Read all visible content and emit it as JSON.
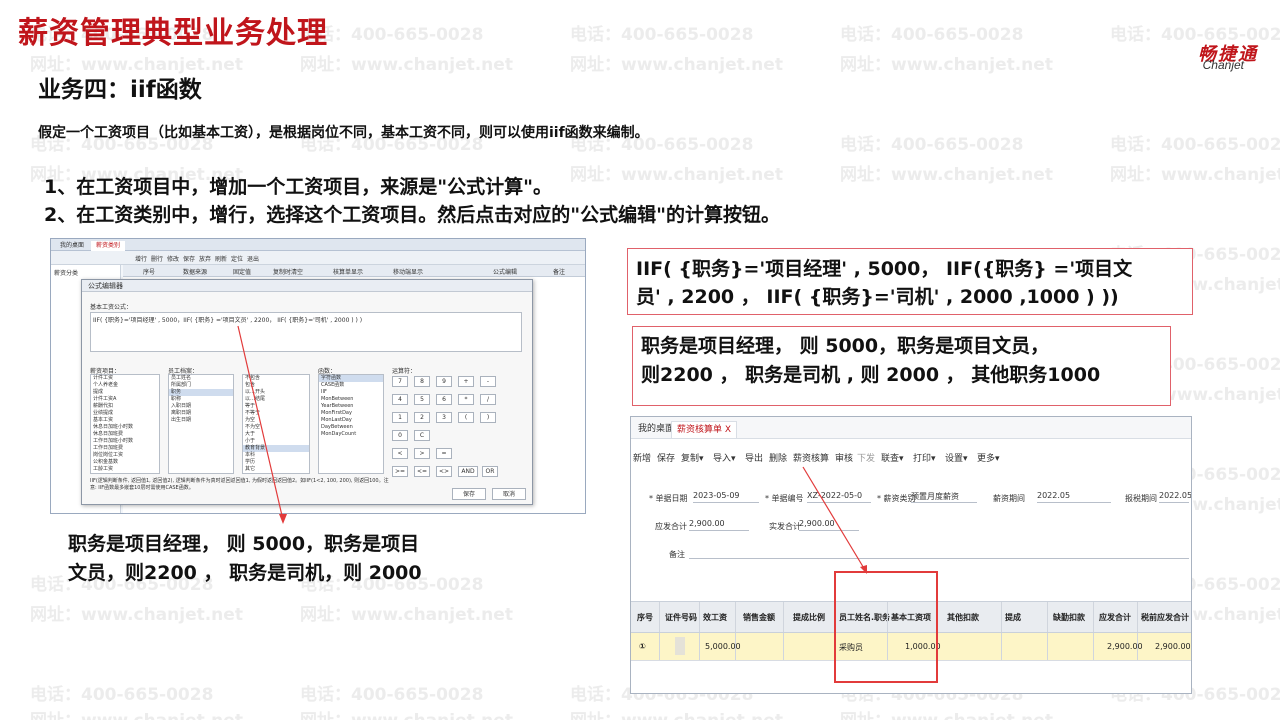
{
  "header": {
    "title": "薪资管理典型业务处理",
    "logo_cn": "畅捷通",
    "logo_en": "Chanjet"
  },
  "watermark": {
    "phone": "电话：400-665-0028",
    "web": "网址：www.chanjet.net"
  },
  "section": {
    "title": "业务四：iif函数",
    "intro": "假定一个工资项目（比如基本工资），是根据岗位不同，基本工资不同，则可以使用iif函数来编制。",
    "steps": [
      "1、在工资项目中，增加一个工资项目，来源是\"公式计算\"。",
      "2、在工资类别中，增行，选择这个工资项目。然后点击对应的\"公式编辑\"的计算按钮。"
    ]
  },
  "formula_box": {
    "line1": "IIF( {职务}='项目经理' , 5000， IIF({职务} ='项目文",
    "line2": "员' , 2200 ，  IIF( {职务}='司机' ,  2000 ,1000 ) ))"
  },
  "explain_box": {
    "line1": "职务是项目经理， 则 5000，职务是项目文员，",
    "line2": "则2200 ， 职务是司机 , 则 2000 ， 其他职务1000"
  },
  "left_explain": {
    "line1": "职务是项目经理， 则 5000，职务是项目",
    "line2": "文员，则2200 ， 职务是司机，则 2000"
  },
  "left_shot": {
    "tabs": [
      "我的桌面",
      "薪资类别"
    ],
    "toolbar": [
      "增行",
      "删行",
      "修改",
      "保存",
      "放弃",
      "刷新",
      "定位",
      "退出"
    ],
    "tree_title": "薪资分类",
    "grid_headers": [
      "序号",
      "数据来源",
      "固定值",
      "复制时清空",
      "核算单显示",
      "移动端显示",
      "公式编辑",
      "备注"
    ],
    "dialog": {
      "title": "公式编辑器",
      "label_formula": "基本工资公式：",
      "formula_text": "IIF( {职务}='项目经理' , 5000，IIF( {职务} ='项目文员' , 2200， IIF( {职务}='司机' ,  2000 ) ) )",
      "list_labels": [
        "薪资项目：",
        "员工档案：",
        "函数：",
        "运算符："
      ],
      "salary_items": [
        "计件工资",
        "个人养老金",
        "提成",
        "计件工资A",
        "薪酬代扣",
        "业绩提成",
        "基本工资",
        "休息日加班小时数",
        "休息日加班费",
        "工作日加班小时数",
        "工作日加班费",
        "岗位岗位工资",
        "公积金基数",
        "工龄工资"
      ],
      "employee_items": [
        "员工姓名",
        "所属部门",
        "职务",
        "职称",
        "入职日期",
        "离职日期",
        "出生日期"
      ],
      "compare_items": [
        "不包含",
        "包含",
        "以…开头",
        "以…结尾",
        "等于",
        "不等于",
        "为空",
        "不为空",
        "大于",
        "小于",
        "教育背景",
        "本科",
        "学历",
        "其它",
        "会计",
        "教师",
        "销售员"
      ],
      "functions": [
        "字符函数",
        "CASE函数",
        "IIF",
        "MonBetween",
        "YearBetween",
        "MonFirstDay",
        "MonLastDay",
        "DayBetween",
        "MonDayCount"
      ],
      "keypad": [
        "7",
        "8",
        "9",
        "+",
        "-",
        "4",
        "5",
        "6",
        "*",
        "/",
        "1",
        "2",
        "3",
        "(",
        ")",
        "0",
        "C",
        "",
        "<",
        ">",
        "<=",
        ">=",
        "=",
        "<>",
        "AND",
        "OR"
      ],
      "hint": "IIF(逻辑判断条件, 返回值1, 返回值2), 逻辑判断条件为真时返回返回值1, 为假时返回返回值2。如IIF(1<2, 100, 200), 则返回100。注意: IIF函数最多嵌套10层时需使用CASE函数。",
      "save": "保存",
      "cancel": "取消"
    }
  },
  "right_shot": {
    "tabs": [
      "我的桌面",
      "薪资核算单 X"
    ],
    "toolbar": [
      "新增",
      "保存",
      "复制▾",
      "导入▾",
      "导出",
      "删除",
      "薪资核算",
      "审核",
      "下发",
      "联查▾",
      "打印▾",
      "设置▾",
      "更多▾"
    ],
    "fields": {
      "bill_date_label": "* 单据日期",
      "bill_date": "2023-05-09",
      "bill_no_label": "* 单据编号",
      "bill_no": "XZ-2022-05-0",
      "category_label": "* 薪资类别",
      "category": "预置月度薪资",
      "period_label": "薪资期间",
      "period": "2022.05",
      "report_label": "报税期间",
      "report": "2022.05",
      "payable_label": "应发合计",
      "payable": "2,900.00",
      "actual_label": "实发合计",
      "actual": "2,900.00",
      "note_label": "备注"
    },
    "table_headers": [
      "序号",
      "证件号码",
      "效工资",
      "销售金额",
      "提成比例",
      "员工姓名.职务",
      "基本工资项",
      "其他扣款",
      "提成",
      "缺勤扣款",
      "应发合计",
      "税前应发合计"
    ],
    "row": {
      "seq": "①",
      "salary": "5,000.00",
      "position": "采购员",
      "base": "1,000.00",
      "total": "2,900.00",
      "pretax": "2,900.00"
    }
  }
}
